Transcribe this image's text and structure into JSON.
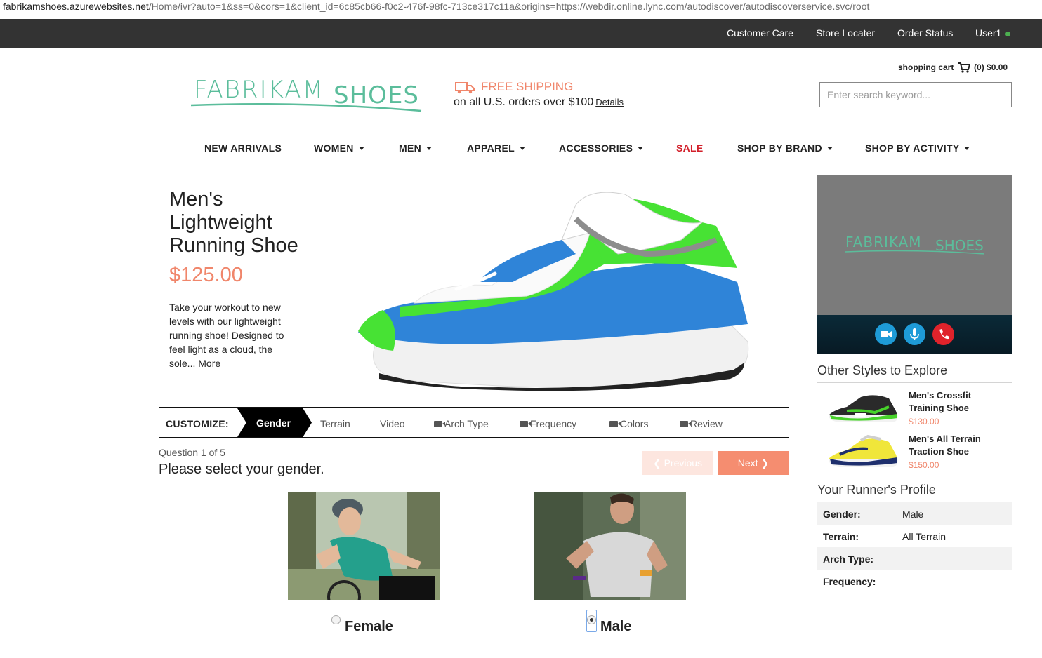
{
  "browser": {
    "url_host": "fabrikamshoes.azurewebsites.net",
    "url_rest": "/Home/ivr?auto=1&ss=0&cors=1&client_id=6c85cb66-f0c2-476f-98fc-713ce317c11a&origins=https://webdir.online.lync.com/autodiscover/autodiscoverservice.svc/root"
  },
  "topbar": {
    "customer_care": "Customer Care",
    "store_locater": "Store Locater",
    "order_status": "Order Status",
    "user": "User1"
  },
  "header": {
    "logo_word1": "FABRIKAM",
    "logo_word2": "SHOES",
    "free_shipping": "FREE SHIPPING",
    "shipping_note": "on all U.S. orders over $100",
    "details_link": "Details",
    "cart_label": "shopping cart",
    "cart_count": "(0)",
    "cart_total": "$0.00",
    "search_placeholder": "Enter search keyword..."
  },
  "nav": {
    "new_arrivals": "NEW ARRIVALS",
    "women": "WOMEN",
    "men": "MEN",
    "apparel": "APPAREL",
    "accessories": "ACCESSORIES",
    "sale": "SALE",
    "shop_by_brand": "SHOP BY BRAND",
    "shop_by_activity": "SHOP BY ACTIVITY"
  },
  "product": {
    "title": "Men's Lightweight Running Shoe",
    "price": "$125.00",
    "description": "Take your workout to new levels with our lightweight running shoe! Designed to feel light as a cloud, the sole...",
    "more_link": "More"
  },
  "video_call": {
    "logo_word1": "FABRIKAM",
    "logo_word2": "SHOES"
  },
  "other_styles": {
    "heading": "Other Styles to Explore",
    "items": [
      {
        "name": "Men's Crossfit Training Shoe",
        "price": "$130.00"
      },
      {
        "name": "Men's All Terrain Traction Shoe",
        "price": "$150.00"
      }
    ]
  },
  "profile": {
    "heading": "Your Runner's Profile",
    "rows": [
      {
        "key": "Gender:",
        "value": "Male"
      },
      {
        "key": "Terrain:",
        "value": "All Terrain"
      },
      {
        "key": "Arch Type:",
        "value": ""
      },
      {
        "key": "Frequency:",
        "value": ""
      }
    ]
  },
  "customize": {
    "label": "CUSTOMIZE:",
    "steps": [
      "Gender",
      "Terrain",
      "Video",
      "Arch Type",
      "Frequency",
      "Colors",
      "Review"
    ]
  },
  "question": {
    "counter": "Question 1 of 5",
    "text": "Please select your gender.",
    "previous": "Previous",
    "next": "Next",
    "option_female": "Female",
    "option_male": "Male",
    "selected": "Male"
  },
  "colors": {
    "accent": "#f0866b",
    "brand_green": "#5bbd9b",
    "topbar": "#333333",
    "sale": "#d21f2a"
  }
}
